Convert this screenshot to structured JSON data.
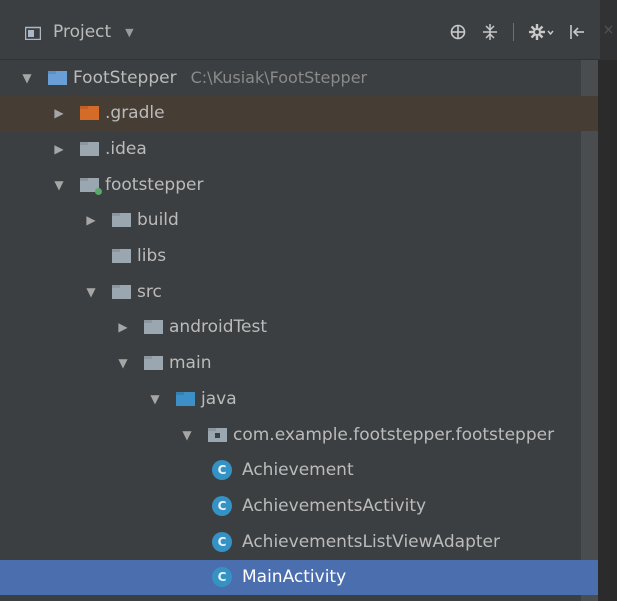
{
  "header": {
    "title": "Project",
    "dropdown_icon": "caret-down",
    "tools": [
      "crosshair-icon",
      "collapse-icon",
      "gear-icon",
      "pin-left-icon"
    ]
  },
  "tree": {
    "rows": [
      {
        "label": "FootStepper",
        "hint": "C:\\Kusiak\\FootStepper",
        "depth": 0,
        "expanded": true,
        "icon": "project-folder"
      },
      {
        "label": ".gradle",
        "depth": 1,
        "expanded": false,
        "icon": "orange-folder"
      },
      {
        "label": ".idea",
        "depth": 1,
        "expanded": false,
        "icon": "folder"
      },
      {
        "label": "footstepper",
        "depth": 1,
        "expanded": true,
        "icon": "module-folder"
      },
      {
        "label": "build",
        "depth": 2,
        "expanded": false,
        "icon": "folder"
      },
      {
        "label": "libs",
        "depth": 2,
        "leaf": true,
        "icon": "folder"
      },
      {
        "label": "src",
        "depth": 2,
        "expanded": true,
        "icon": "folder"
      },
      {
        "label": "androidTest",
        "depth": 3,
        "expanded": false,
        "icon": "folder"
      },
      {
        "label": "main",
        "depth": 3,
        "expanded": true,
        "icon": "folder"
      },
      {
        "label": "java",
        "depth": 4,
        "expanded": true,
        "icon": "source-folder"
      },
      {
        "label": "com.example.footstepper.footstepper",
        "depth": 5,
        "expanded": true,
        "icon": "package-folder"
      },
      {
        "label": "Achievement",
        "depth": 6,
        "leaf": true,
        "icon": "class"
      },
      {
        "label": "AchievementsActivity",
        "depth": 6,
        "leaf": true,
        "icon": "class"
      },
      {
        "label": "AchievementsListViewAdapter",
        "depth": 6,
        "leaf": true,
        "icon": "class"
      },
      {
        "label": "MainActivity",
        "depth": 6,
        "leaf": true,
        "icon": "class",
        "selected": true
      }
    ]
  },
  "class_icon_letter": "C",
  "colors": {
    "panel_bg": "#3c3f41",
    "selection": "#4b6eaf",
    "gradle_highlight": "#463e35",
    "class_icon": "#3592c4"
  }
}
